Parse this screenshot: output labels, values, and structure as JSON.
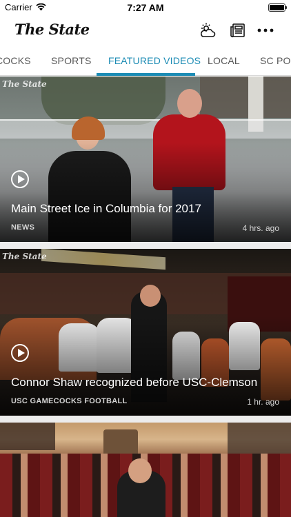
{
  "status_bar": {
    "carrier": "Carrier",
    "time": "7:27 AM"
  },
  "header": {
    "logo": "The State",
    "icons": [
      "weather-icon",
      "e-edition-icon",
      "more-icon"
    ]
  },
  "tabs": [
    {
      "label": "COCKS"
    },
    {
      "label": "SPORTS"
    },
    {
      "label": "FEATURED VIDEOS",
      "active": true
    },
    {
      "label": "LOCAL"
    },
    {
      "label": "SC POLI"
    }
  ],
  "cards": [
    {
      "watermark": "The State",
      "title": "Main Street Ice in Columbia for 2017",
      "section": "NEWS",
      "time": "4 hrs. ago"
    },
    {
      "watermark": "The State",
      "title": "Connor Shaw recognized before USC-Clemson",
      "section": "USC GAMECOCKS FOOTBALL",
      "time": "1 hr. ago"
    },
    {
      "title": ""
    }
  ],
  "colors": {
    "accent": "#1b8bb4",
    "tab_text": "#555555"
  }
}
